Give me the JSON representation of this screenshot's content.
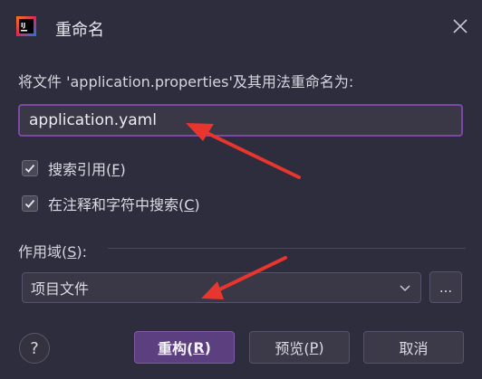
{
  "dialog": {
    "title": "重命名",
    "app_icon": "intellij-icon",
    "close_icon": "close-icon"
  },
  "prompt": "将文件 'application.properties'及其用法重命名为:",
  "new_name": {
    "value": "application.yaml"
  },
  "options": {
    "search_refs": {
      "label": "搜索引用(",
      "mnemonic": "F",
      "suffix": ")",
      "checked": true
    },
    "search_comments": {
      "label": "在注释和字符中搜索(",
      "mnemonic": "C",
      "suffix": ")",
      "checked": true
    }
  },
  "scope": {
    "label": "作用域(",
    "mnemonic": "S",
    "suffix": "):",
    "selected": "项目文件",
    "browse_label": "..."
  },
  "buttons": {
    "help": "?",
    "refactor_label": "重构(",
    "refactor_mnemonic": "R",
    "refactor_suffix": ")",
    "preview_label": "预览(",
    "preview_mnemonic": "P",
    "preview_suffix": ")",
    "cancel": "取消"
  },
  "colors": {
    "accent": "#7d47a6",
    "primary_button": "#5b3f7e",
    "annotation_arrow": "#e8352d"
  }
}
